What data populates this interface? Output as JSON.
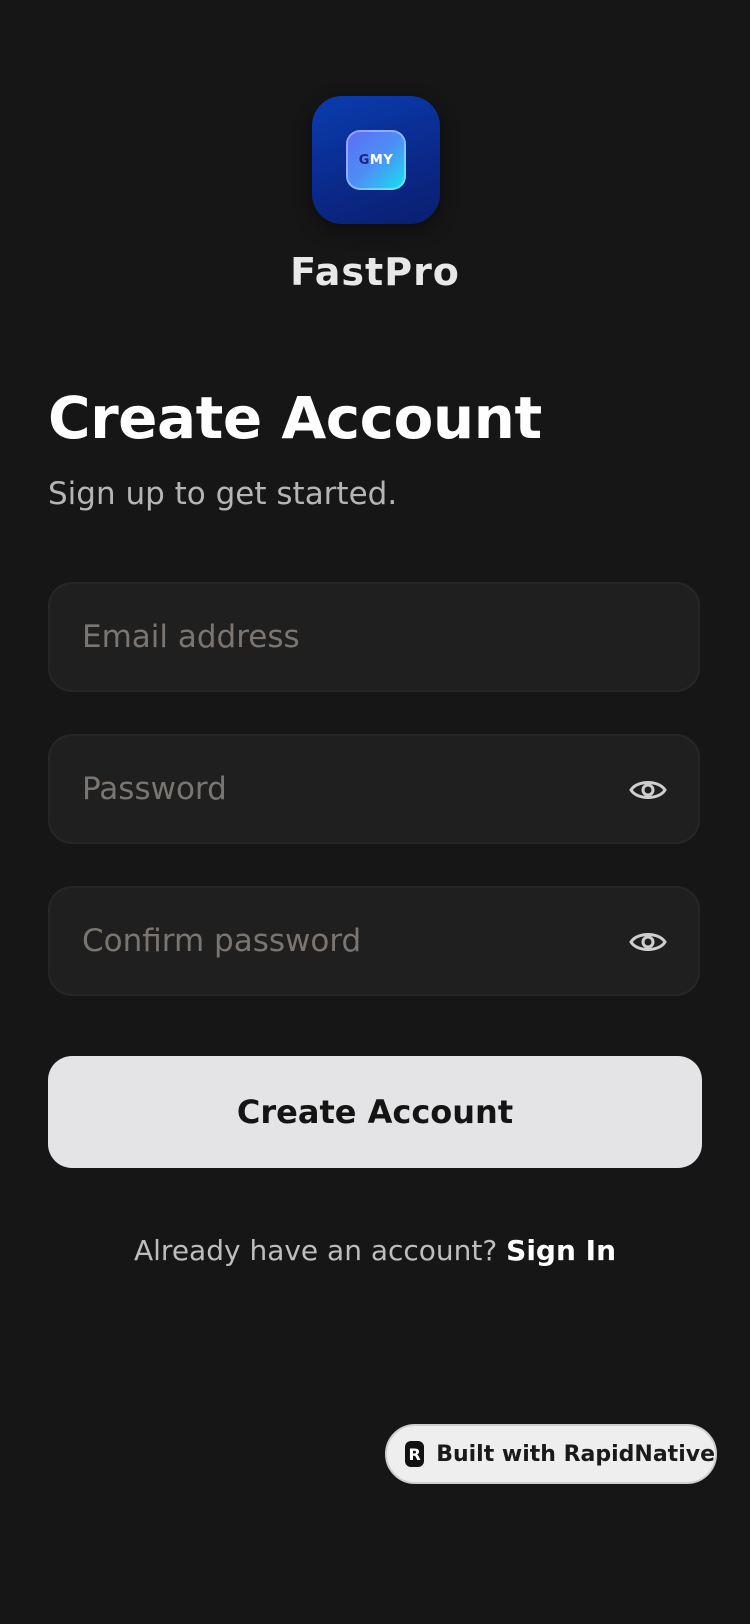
{
  "app": {
    "name": "FastPro",
    "logo_text_g": "G",
    "logo_text_my": "MY"
  },
  "header": {
    "title": "Create Account",
    "subtitle": "Sign up to get started."
  },
  "form": {
    "email_placeholder": "Email address",
    "email_value": "",
    "password_placeholder": "Password",
    "password_value": "",
    "confirm_placeholder": "Confirm password",
    "confirm_value": "",
    "submit_label": "Create Account"
  },
  "footer": {
    "prompt": "Already have an account?",
    "link_label": "Sign In"
  },
  "badge": {
    "icon_letter": "R",
    "label": "Built with RapidNative"
  },
  "icons": {
    "password_toggle": "eye-icon",
    "confirm_toggle": "eye-icon"
  },
  "colors": {
    "background": "#161616",
    "field_bg": "#1f1f1f",
    "button_bg": "#e4e4e6",
    "logo_start": "#0a3db0",
    "logo_accent": "#14e3f3"
  }
}
